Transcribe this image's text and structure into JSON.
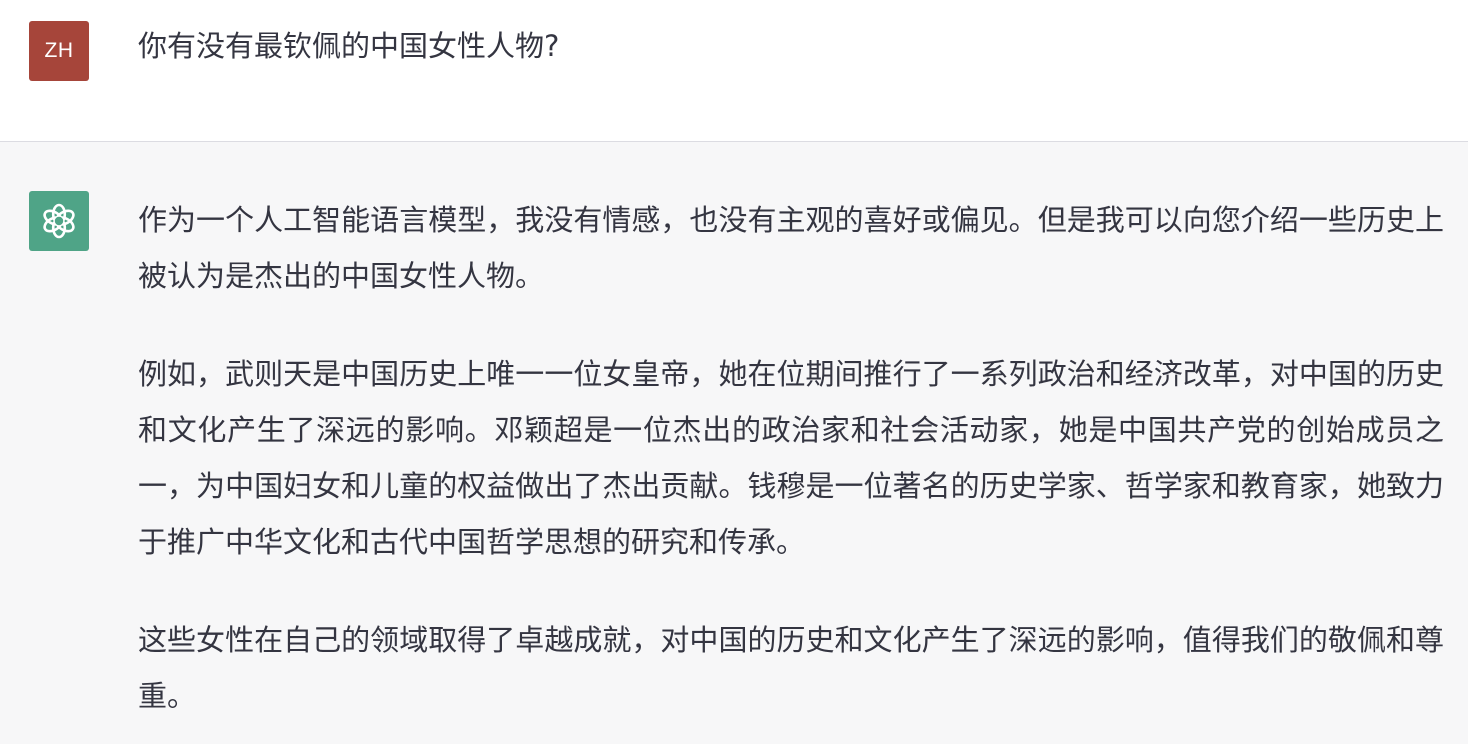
{
  "conversation": {
    "user": {
      "avatar_initials": "ZH",
      "avatar_color": "#a6453a",
      "message": "你有没有最钦佩的中国女性人物?"
    },
    "assistant": {
      "avatar_icon": "openai-logo-icon",
      "avatar_color": "#4fa487",
      "paragraphs": [
        "作为一个人工智能语言模型，我没有情感，也没有主观的喜好或偏见。但是我可以向您介绍一些历史上被认为是杰出的中国女性人物。",
        "例如，武则天是中国历史上唯一一位女皇帝，她在位期间推行了一系列政治和经济改革，对中国的历史和文化产生了深远的影响。邓颖超是一位杰出的政治家和社会活动家，她是中国共产党的创始成员之一，为中国妇女和儿童的权益做出了杰出贡献。钱穆是一位著名的历史学家、哲学家和教育家，她致力于推广中华文化和古代中国哲学思想的研究和传承。",
        "这些女性在自己的领域取得了卓越成就，对中国的历史和文化产生了深远的影响，值得我们的敬佩和尊重。"
      ]
    }
  }
}
